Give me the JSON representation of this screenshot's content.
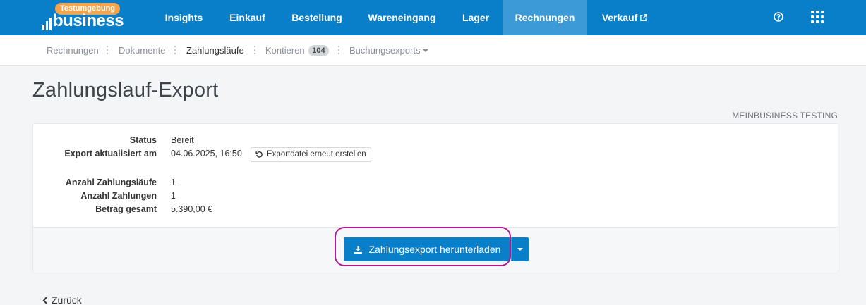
{
  "app": {
    "badge": "Testumgebung",
    "logo_text": "business"
  },
  "nav": {
    "items": [
      {
        "label": "Insights"
      },
      {
        "label": "Einkauf"
      },
      {
        "label": "Bestellung"
      },
      {
        "label": "Wareneingang"
      },
      {
        "label": "Lager"
      },
      {
        "label": "Rechnungen"
      },
      {
        "label": "Verkauf"
      }
    ],
    "active": "Rechnungen",
    "icons": [
      "question-circle-icon",
      "apps-grid-icon",
      "external-link-icon"
    ]
  },
  "subnav": {
    "items": [
      {
        "label": "Rechnungen"
      },
      {
        "label": "Dokumente"
      },
      {
        "label": "Zahlungsläufe"
      },
      {
        "label": "Kontieren",
        "badge": "104"
      },
      {
        "label": "Buchungsexports"
      }
    ],
    "active": "Zahlungsläufe"
  },
  "page": {
    "title": "Zahlungslauf-Export",
    "company": "MEINBUSINESS TESTING"
  },
  "details": {
    "status_label": "Status",
    "status_value": "Bereit",
    "updated_label": "Export aktualisiert am",
    "updated_value": "04.06.2025, 16:50",
    "regenerate_label": "Exportdatei erneut erstellen",
    "runs_label": "Anzahl Zahlungsläufe",
    "runs_value": "1",
    "payments_label": "Anzahl Zahlungen",
    "payments_value": "1",
    "total_label": "Betrag gesamt",
    "total_value": "5.390,00 €"
  },
  "actions": {
    "download_label": "Zahlungsexport herunterladen",
    "back_label": "Zurück"
  },
  "colors": {
    "primary": "#0a7fc9",
    "nav_active": "#3c9ad6",
    "badge": "#f3a34a",
    "highlight": "#b0198f"
  }
}
